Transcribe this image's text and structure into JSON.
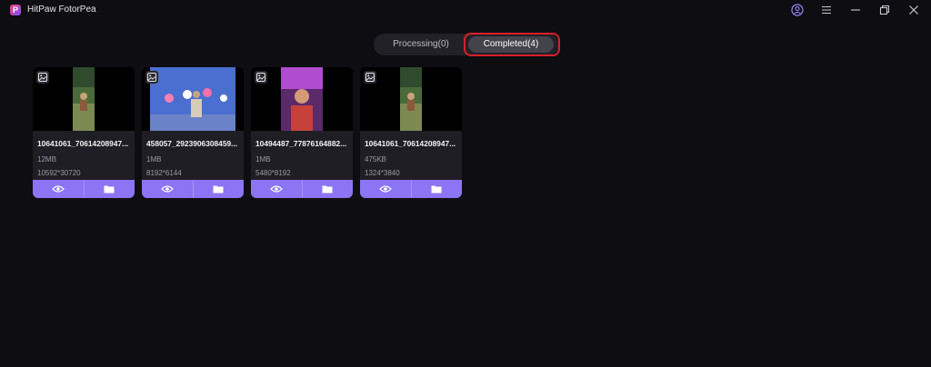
{
  "app": {
    "title": "HitPaw FotorPea",
    "logo_letter": "P"
  },
  "window_controls": [
    "account-icon",
    "menu-icon",
    "minimize-icon",
    "restore-icon",
    "close-icon"
  ],
  "tabs": [
    {
      "label": "Processing(0)",
      "active": false
    },
    {
      "label": "Completed(4)",
      "active": true
    }
  ],
  "files": [
    {
      "name": "10641061_70614208947...",
      "size": "12MB",
      "dimensions": "10592*30720"
    },
    {
      "name": "458057_2923906308459...",
      "size": "1MB",
      "dimensions": "8192*6144"
    },
    {
      "name": "10494487_77876164882...",
      "size": "1MB",
      "dimensions": "5480*8192"
    },
    {
      "name": "10641061_70614208947...",
      "size": "475KB",
      "dimensions": "1324*3840"
    }
  ],
  "colors": {
    "background": "#0e0d11",
    "card": "#1f1e25",
    "action_bar": "#8b75f5",
    "highlight": "#d8202a"
  }
}
